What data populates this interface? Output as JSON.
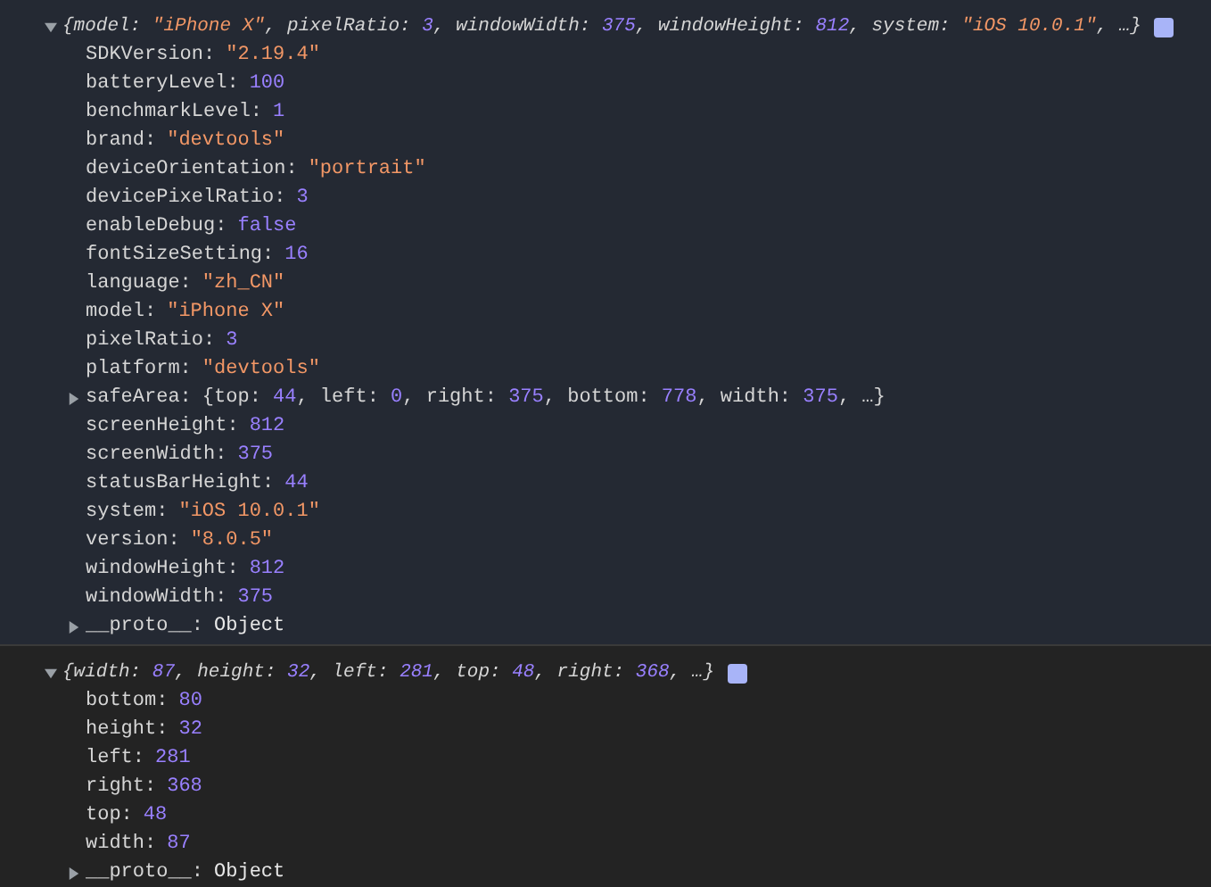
{
  "entries": [
    {
      "expanded": true,
      "summary": [
        {
          "text": "{model: ",
          "kind": "text"
        },
        {
          "text": "\"iPhone X\"",
          "kind": "string"
        },
        {
          "text": ", pixelRatio: ",
          "kind": "text"
        },
        {
          "text": "3",
          "kind": "number"
        },
        {
          "text": ", windowWidth: ",
          "kind": "text"
        },
        {
          "text": "375",
          "kind": "number"
        },
        {
          "text": ", windowHeight: ",
          "kind": "text"
        },
        {
          "text": "812",
          "kind": "number"
        },
        {
          "text": ", system: ",
          "kind": "text"
        },
        {
          "text": "\"iOS 10.0.1\"",
          "kind": "string"
        },
        {
          "text": ", …}",
          "kind": "text"
        }
      ],
      "properties": [
        {
          "key": "SDKVersion:",
          "value": "\"2.19.4\"",
          "kind": "string"
        },
        {
          "key": "batteryLevel:",
          "value": "100",
          "kind": "number"
        },
        {
          "key": "benchmarkLevel:",
          "value": "1",
          "kind": "number"
        },
        {
          "key": "brand:",
          "value": "\"devtools\"",
          "kind": "string"
        },
        {
          "key": "deviceOrientation:",
          "value": "\"portrait\"",
          "kind": "string"
        },
        {
          "key": "devicePixelRatio:",
          "value": "3",
          "kind": "number"
        },
        {
          "key": "enableDebug:",
          "value": "false",
          "kind": "boolean"
        },
        {
          "key": "fontSizeSetting:",
          "value": "16",
          "kind": "number"
        },
        {
          "key": "language:",
          "value": "\"zh_CN\"",
          "kind": "string"
        },
        {
          "key": "model:",
          "value": "\"iPhone X\"",
          "kind": "string"
        },
        {
          "key": "pixelRatio:",
          "value": "3",
          "kind": "number"
        },
        {
          "key": "platform:",
          "value": "\"devtools\"",
          "kind": "string"
        },
        {
          "key": "safeArea:",
          "expanded": false,
          "preview": [
            {
              "text": "{top: ",
              "kind": "text"
            },
            {
              "text": "44",
              "kind": "number"
            },
            {
              "text": ", left: ",
              "kind": "text"
            },
            {
              "text": "0",
              "kind": "number"
            },
            {
              "text": ", right: ",
              "kind": "text"
            },
            {
              "text": "375",
              "kind": "number"
            },
            {
              "text": ", bottom: ",
              "kind": "text"
            },
            {
              "text": "778",
              "kind": "number"
            },
            {
              "text": ", width: ",
              "kind": "text"
            },
            {
              "text": "375",
              "kind": "number"
            },
            {
              "text": ", …}",
              "kind": "text"
            }
          ]
        },
        {
          "key": "screenHeight:",
          "value": "812",
          "kind": "number"
        },
        {
          "key": "screenWidth:",
          "value": "375",
          "kind": "number"
        },
        {
          "key": "statusBarHeight:",
          "value": "44",
          "kind": "number"
        },
        {
          "key": "system:",
          "value": "\"iOS 10.0.1\"",
          "kind": "string"
        },
        {
          "key": "version:",
          "value": "\"8.0.5\"",
          "kind": "string"
        },
        {
          "key": "windowHeight:",
          "value": "812",
          "kind": "number"
        },
        {
          "key": "windowWidth:",
          "value": "375",
          "kind": "number"
        },
        {
          "key": "__proto__:",
          "value": "Object",
          "kind": "object",
          "expanded": false
        }
      ]
    },
    {
      "expanded": true,
      "summary": [
        {
          "text": "{width: ",
          "kind": "text"
        },
        {
          "text": "87",
          "kind": "number"
        },
        {
          "text": ", height: ",
          "kind": "text"
        },
        {
          "text": "32",
          "kind": "number"
        },
        {
          "text": ", left: ",
          "kind": "text"
        },
        {
          "text": "281",
          "kind": "number"
        },
        {
          "text": ", top: ",
          "kind": "text"
        },
        {
          "text": "48",
          "kind": "number"
        },
        {
          "text": ", right: ",
          "kind": "text"
        },
        {
          "text": "368",
          "kind": "number"
        },
        {
          "text": ", …}",
          "kind": "text"
        }
      ],
      "properties": [
        {
          "key": "bottom:",
          "value": "80",
          "kind": "number"
        },
        {
          "key": "height:",
          "value": "32",
          "kind": "number"
        },
        {
          "key": "left:",
          "value": "281",
          "kind": "number"
        },
        {
          "key": "right:",
          "value": "368",
          "kind": "number"
        },
        {
          "key": "top:",
          "value": "48",
          "kind": "number"
        },
        {
          "key": "width:",
          "value": "87",
          "kind": "number"
        },
        {
          "key": "__proto__:",
          "value": "Object",
          "kind": "object",
          "expanded": false
        }
      ]
    }
  ]
}
